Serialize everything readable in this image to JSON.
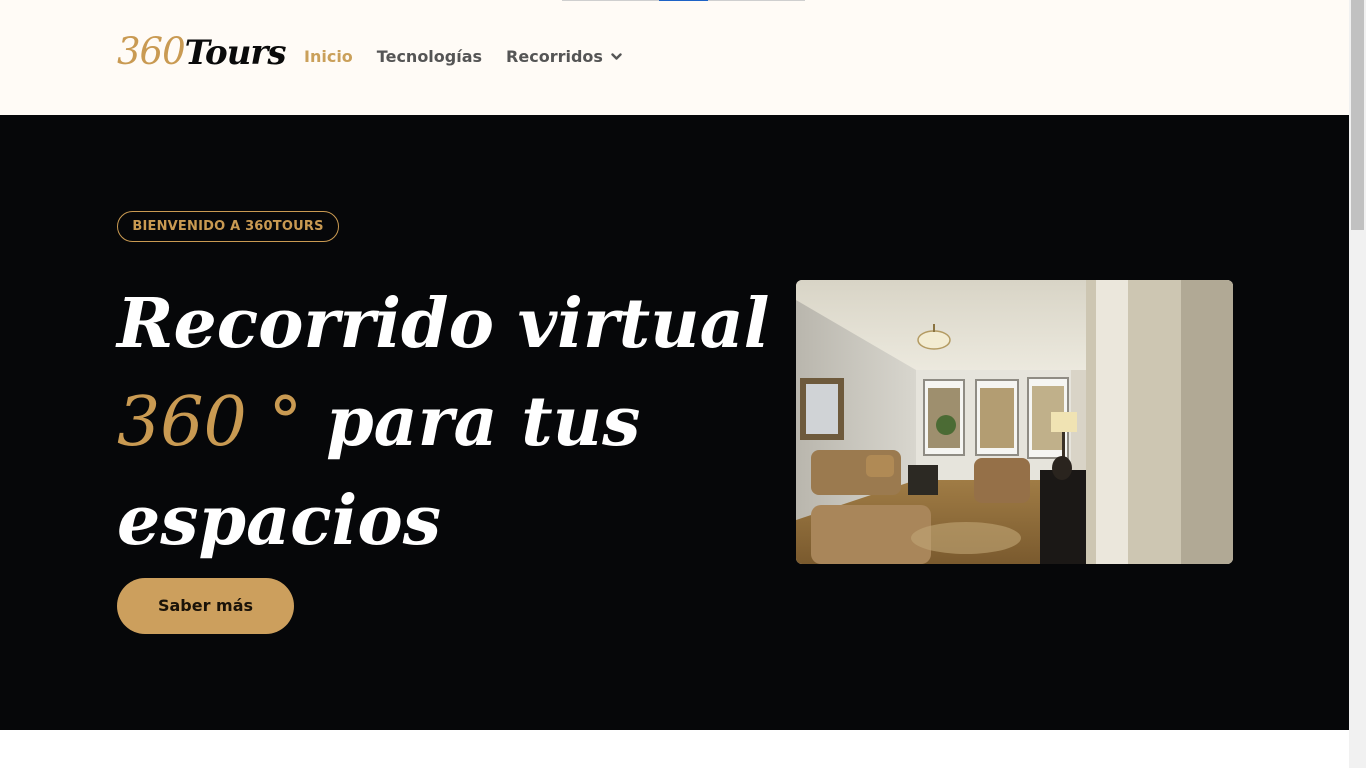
{
  "brand": {
    "number": "360",
    "word": "Tours"
  },
  "nav": {
    "items": [
      {
        "label": "Inicio",
        "active": true
      },
      {
        "label": "Tecnologías",
        "active": false
      },
      {
        "label": "Recorridos",
        "active": false,
        "has_dropdown": true
      }
    ]
  },
  "hero": {
    "badge": "BIENVENIDO A 360TOURS",
    "headline_line1": "Recorrido virtual",
    "headline_accent": "360 °",
    "headline_line2_rest": " para tus",
    "headline_line3": "espacios",
    "cta_label": "Saber más",
    "image_icon": "living-room-photo"
  },
  "colors": {
    "accent": "#c99a52",
    "hero_background": "#060709",
    "header_background": "#fffbf6",
    "cta_background": "#cc9f5d"
  }
}
